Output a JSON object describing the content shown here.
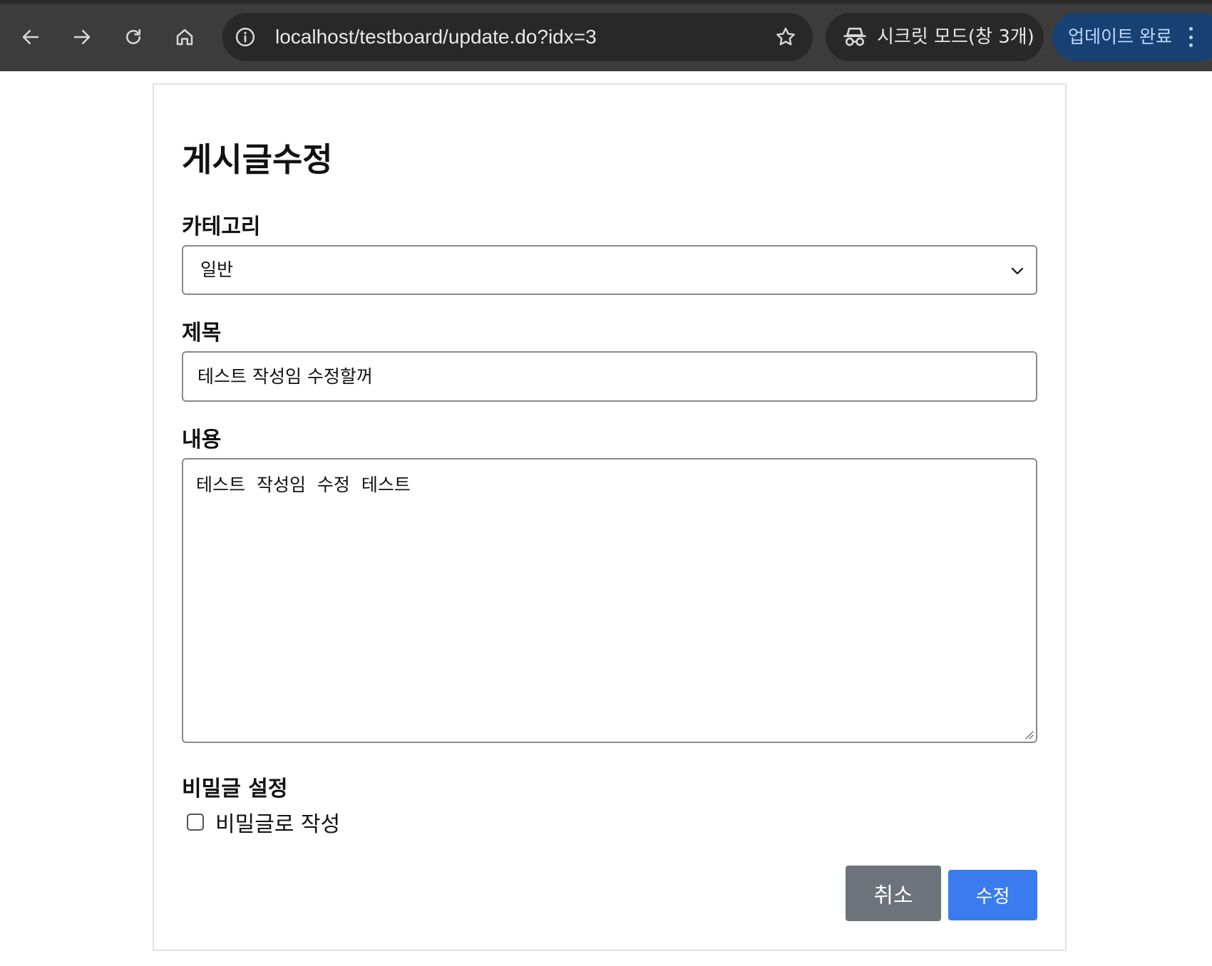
{
  "browser": {
    "url": "localhost/testboard/update.do?idx=3",
    "incognito_label": "시크릿 모드(창 3개)",
    "update_label": "업데이트 완료",
    "icons": [
      "back-icon",
      "forward-icon",
      "reload-icon",
      "home-icon",
      "site-info-icon",
      "bookmark-star-icon",
      "incognito-icon",
      "more-menu-icon"
    ],
    "colors": {
      "toolbar": "#3c3c3c",
      "omnibox": "#282828",
      "update_pill": "#174172"
    }
  },
  "form": {
    "title": "게시글수정",
    "category": {
      "label": "카테고리",
      "selected": "일반"
    },
    "subject": {
      "label": "제목",
      "value": "테스트 작성임 수정할꺼"
    },
    "content": {
      "label": "내용",
      "value": "테스트 작성임 수정 테스트"
    },
    "secret": {
      "label": "비밀글 설정",
      "checkbox_label": "비밀글로 작성",
      "checked": false
    },
    "buttons": {
      "cancel": "취소",
      "submit": "수정"
    },
    "colors": {
      "cancel": "#6c737b",
      "submit": "#3a7cf0"
    }
  }
}
